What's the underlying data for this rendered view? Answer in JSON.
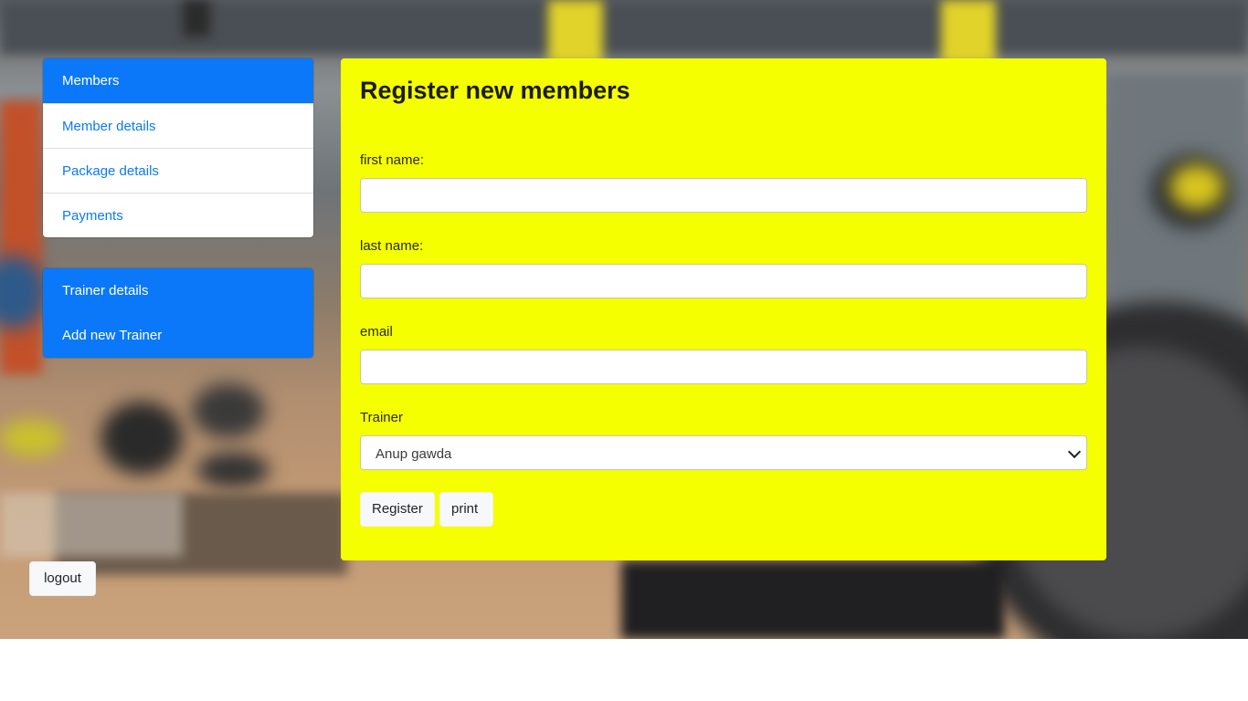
{
  "sidebar": {
    "members_group": [
      {
        "label": "Members",
        "active": true
      },
      {
        "label": "Member details",
        "active": false
      },
      {
        "label": "Package details",
        "active": false
      },
      {
        "label": "Payments",
        "active": false
      }
    ],
    "trainer_group": [
      {
        "label": "Trainer details"
      },
      {
        "label": "Add new Trainer"
      }
    ]
  },
  "form": {
    "title": "Register new members",
    "first_name_label": "first name:",
    "first_name_value": "",
    "last_name_label": "last name:",
    "last_name_value": "",
    "email_label": "email",
    "email_value": "",
    "trainer_label": "Trainer",
    "trainer_selected": "Anup gawda",
    "register_label": "Register",
    "print_label": "print"
  },
  "logout_label": "logout",
  "colors": {
    "accent_blue": "#0a78f9",
    "card_yellow": "#f5ff00",
    "link_blue": "#0b7bef"
  }
}
